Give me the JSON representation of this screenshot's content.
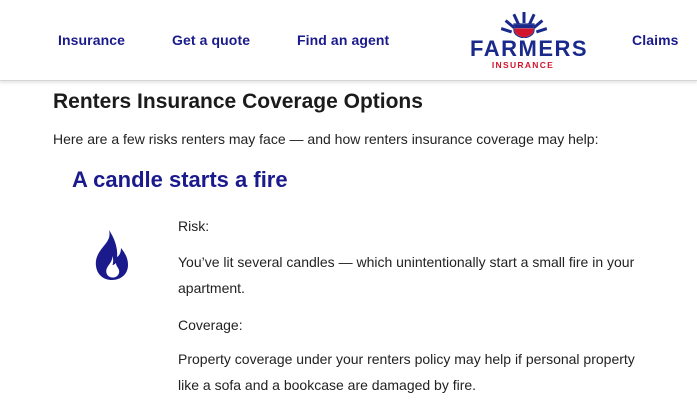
{
  "nav": {
    "links": [
      "Insurance",
      "Get a quote",
      "Find an agent",
      "Claims"
    ],
    "logo": {
      "word": "FARMERS",
      "sub": "INSURANCE"
    }
  },
  "page": {
    "title": "Renters Insurance Coverage Options",
    "intro": "Here are a few risks renters may face — and how renters insurance coverage may help:"
  },
  "section": {
    "title": "A candle starts a fire",
    "icon": "flame-icon",
    "risk_label": "Risk:",
    "risk_lines": [
      "You’ve lit several candles — which unintentionally start a small fire in your",
      "apartment."
    ],
    "coverage_label": "Coverage:",
    "coverage_lines": [
      "Property coverage under your renters policy may help if personal property",
      "like a sofa and a bookcase are damaged by fire."
    ]
  },
  "colors": {
    "brand_blue": "#1a1a8c",
    "brand_red": "#d2142c",
    "text": "#222222"
  }
}
